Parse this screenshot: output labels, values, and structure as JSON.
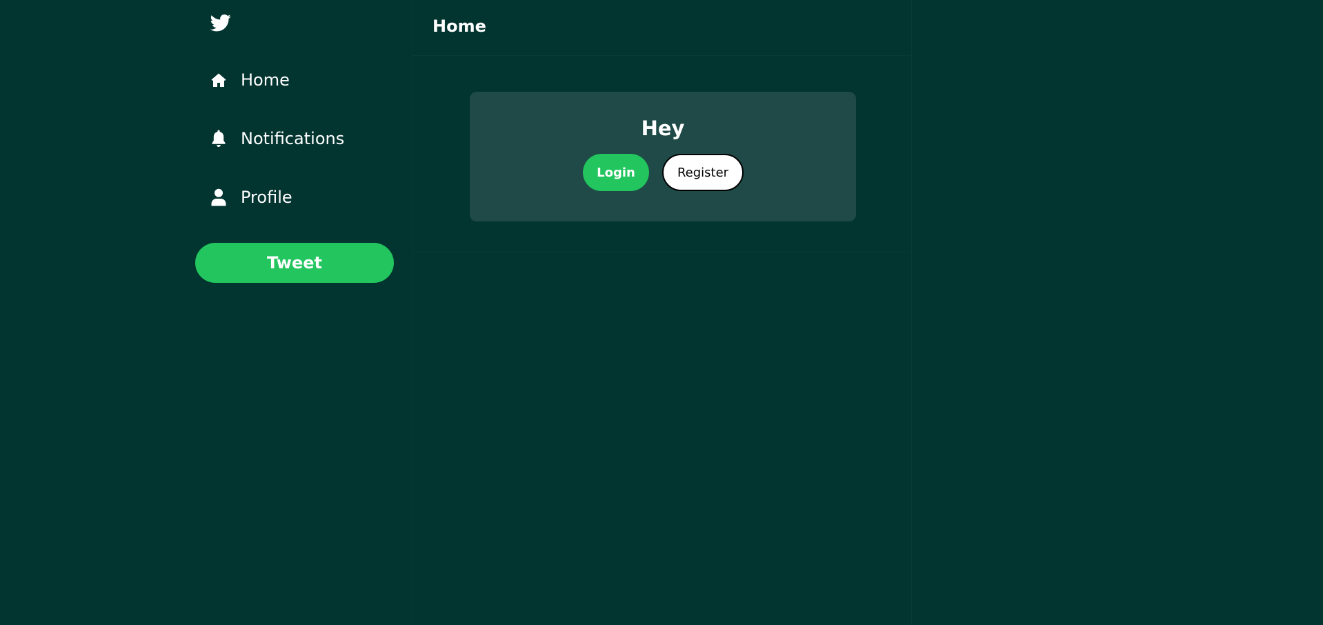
{
  "theme": {
    "background": "#023430",
    "accent": "#22c55e",
    "card_background": "#1f4a48",
    "text": "#ffffff"
  },
  "sidebar": {
    "logo_icon": "twitter-bird-icon",
    "items": [
      {
        "label": "Home",
        "icon": "home-icon"
      },
      {
        "label": "Notifications",
        "icon": "bell-icon"
      },
      {
        "label": "Profile",
        "icon": "user-icon"
      }
    ],
    "tweet_label": "Tweet"
  },
  "main": {
    "title": "Home",
    "card": {
      "title": "Hey",
      "login_label": "Login",
      "register_label": "Register"
    }
  }
}
